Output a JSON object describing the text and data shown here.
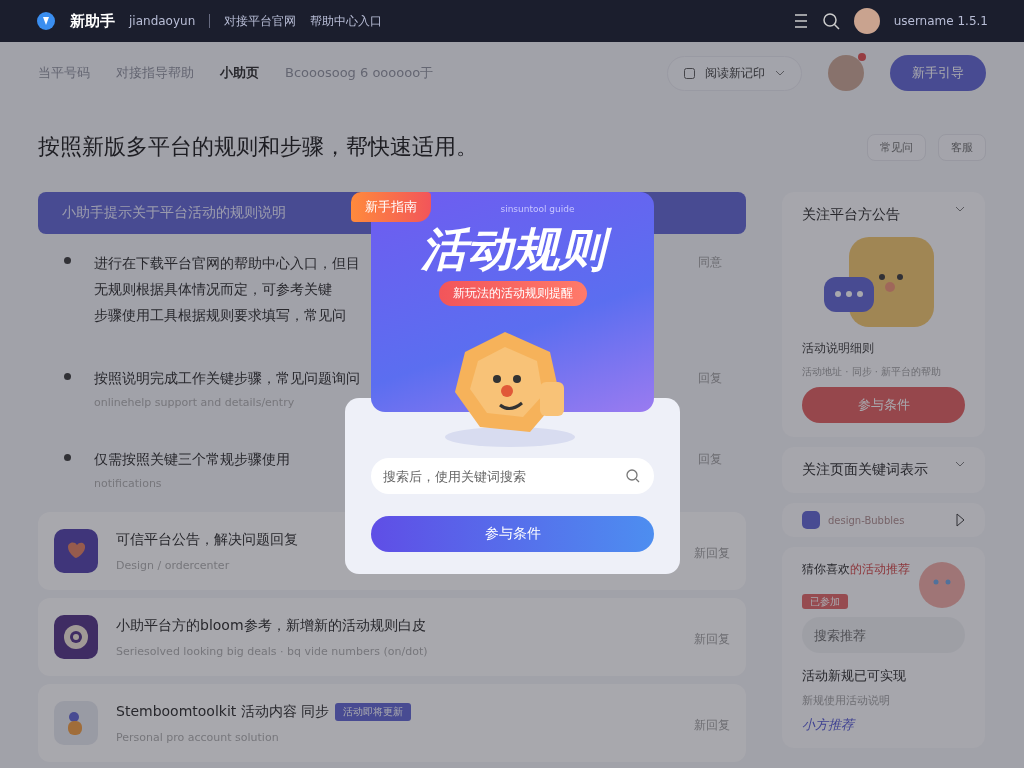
{
  "top_bar": {
    "logo": "新助手",
    "product": "jiandaoyun",
    "links": [
      "对接平台官网",
      "帮助中心入口"
    ],
    "user": "username 1.5.1"
  },
  "sub_nav": {
    "tabs": [
      {
        "label": "当平号码",
        "selected": false
      },
      {
        "label": "对接指导帮助",
        "selected": false
      },
      {
        "label": "小助页",
        "selected": true
      },
      {
        "label": "Bcooosoog 6 oooooo于",
        "selected": false
      }
    ],
    "dropdown": "阅读新记印",
    "button": "新手引导"
  },
  "heading": "按照新版多平台的规则和步骤，帮快速适用。",
  "heading_actions": [
    "常见问",
    "客服"
  ],
  "notice_banner": "小助手提示关于平台活动的规则说明",
  "bullets": [
    {
      "lines": [
        "进行在下载平台官网的帮助中心入口，但目",
        "无规则根据具体情况而定，可参考关键",
        "步骤使用工具根据规则要求填写，常见问"
      ],
      "action": "同意"
    },
    {
      "text": "按照说明完成工作关键步骤，常见问题询问",
      "sub": "onlinehelp support and details/entry",
      "action": "回复"
    },
    {
      "text": "仅需按照关键三个常规步骤使用",
      "sub": "notifications",
      "action": "回复"
    }
  ],
  "articles": [
    {
      "kind": "heart",
      "title": "可信平台公告，解决问题回复",
      "meta": "Design / ordercenter",
      "action": "新回复"
    },
    {
      "kind": "ring",
      "title": "小助平台方的bloom参考，新增新的活动规则白皮",
      "meta": "Seriesolved looking big deals · bq vide numbers (on/dot)",
      "action": "新回复"
    },
    {
      "kind": "figure",
      "title": "Stemboomtoolkit 活动内容 同步",
      "tag": "活动即将更新",
      "meta": "Personal pro account solution",
      "action": "新回复"
    }
  ],
  "sidebar": {
    "announcement": {
      "title": "关注平台方公告",
      "caption": "活动说明细则",
      "meta": "活动地址 · 同步 · 新平台的帮助",
      "button": "参与条件"
    },
    "keywords": {
      "title": "关注页面关键词表示",
      "item": "design-Bubbles"
    },
    "recommend": {
      "title": "猜你喜欢",
      "title_accent": "的活动推荐",
      "tag": "已参加",
      "search_placeholder": "搜索推荐",
      "headline": "活动新规已可实现",
      "desc": "新规使用活动说明",
      "link": "小方推荐"
    }
  },
  "modal": {
    "badge": "新手指南",
    "subtitle": "sinsuntool guide",
    "title": "活动规则",
    "ribbon": "新玩法的活动规则提醒",
    "search_placeholder": "搜索后，使用关键词搜索",
    "button": "参与条件"
  }
}
